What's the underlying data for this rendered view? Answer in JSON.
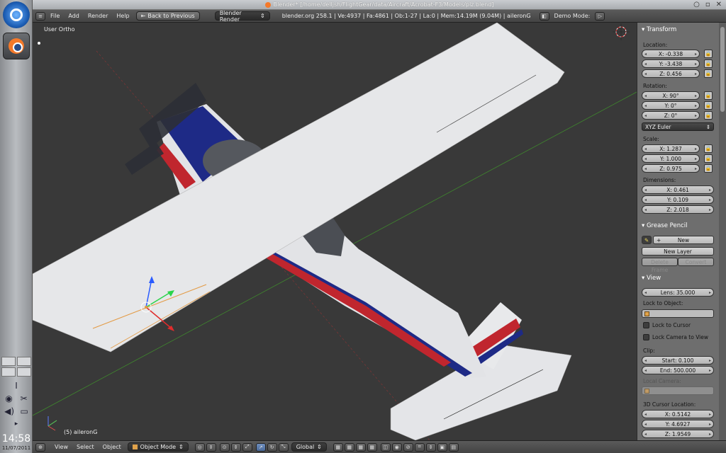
{
  "window": {
    "title": "Blender* [/home/delljsh/FlightGear/data/Aircraft/Acrobat-F3/Models/plz.blend]",
    "controls": [
      "○",
      "▫",
      "✕"
    ]
  },
  "dock": {
    "clock": "14:58",
    "date": "11/07/2011"
  },
  "header": {
    "menus": [
      "File",
      "Add",
      "Render",
      "Help"
    ],
    "back_button": "Back to Previous",
    "render_engine": "Blender Render",
    "stats": "blender.org 258.1 | Ve:4937 | Fa:4861 | Ob:1-27 | La:0 | Mem:14.19M (9.04M) | aileronG",
    "demo_mode": "Demo Mode:"
  },
  "viewport": {
    "view_label": "User Ortho",
    "object_label": "(5) aileronG",
    "colors": {
      "background": "#393939",
      "wing": "#e6e7e9",
      "stripe_blue": "#1e2a86",
      "stripe_red": "#c0262e",
      "grid_green": "#3f8a2d",
      "grid_red": "#8c3434"
    }
  },
  "properties": {
    "transform": {
      "title": "Transform",
      "location_label": "Location:",
      "location": [
        "X: -0.338",
        "Y: -3.438",
        "Z: 0.456"
      ],
      "rotation_label": "Rotation:",
      "rotation": [
        "X: 90°",
        "Y: 0°",
        "Z: 0°"
      ],
      "rotation_mode": "XYZ Euler",
      "scale_label": "Scale:",
      "scale": [
        "X: 1.287",
        "Y: 1.000",
        "Z: 0.975"
      ],
      "dimensions_label": "Dimensions:",
      "dimensions": [
        "X: 0.461",
        "Y: 0.109",
        "Z: 2.018"
      ]
    },
    "grease_pencil": {
      "title": "Grease Pencil",
      "new_button": "New",
      "new_layer_button": "New Layer",
      "delete_frame_button": "Delete Frame",
      "convert_button": "Convert"
    },
    "view": {
      "title": "View",
      "lens": "Lens: 35.000",
      "lock_to_object_label": "Lock to Object:",
      "lock_to_cursor": "Lock to Cursor",
      "lock_camera_to_view": "Lock Camera to View",
      "clip_label": "Clip:",
      "clip_start": "Start: 0.100",
      "clip_end": "End: 500.000",
      "local_camera_label": "Local Camera:",
      "cursor_label": "3D Cursor Location:",
      "cursor": [
        "X: 0.5142",
        "Y: 4.6927",
        "Z: 1.9549"
      ]
    }
  },
  "footer": {
    "menus": [
      "View",
      "Select",
      "Object"
    ],
    "mode": "Object Mode",
    "orientation": "Global"
  }
}
